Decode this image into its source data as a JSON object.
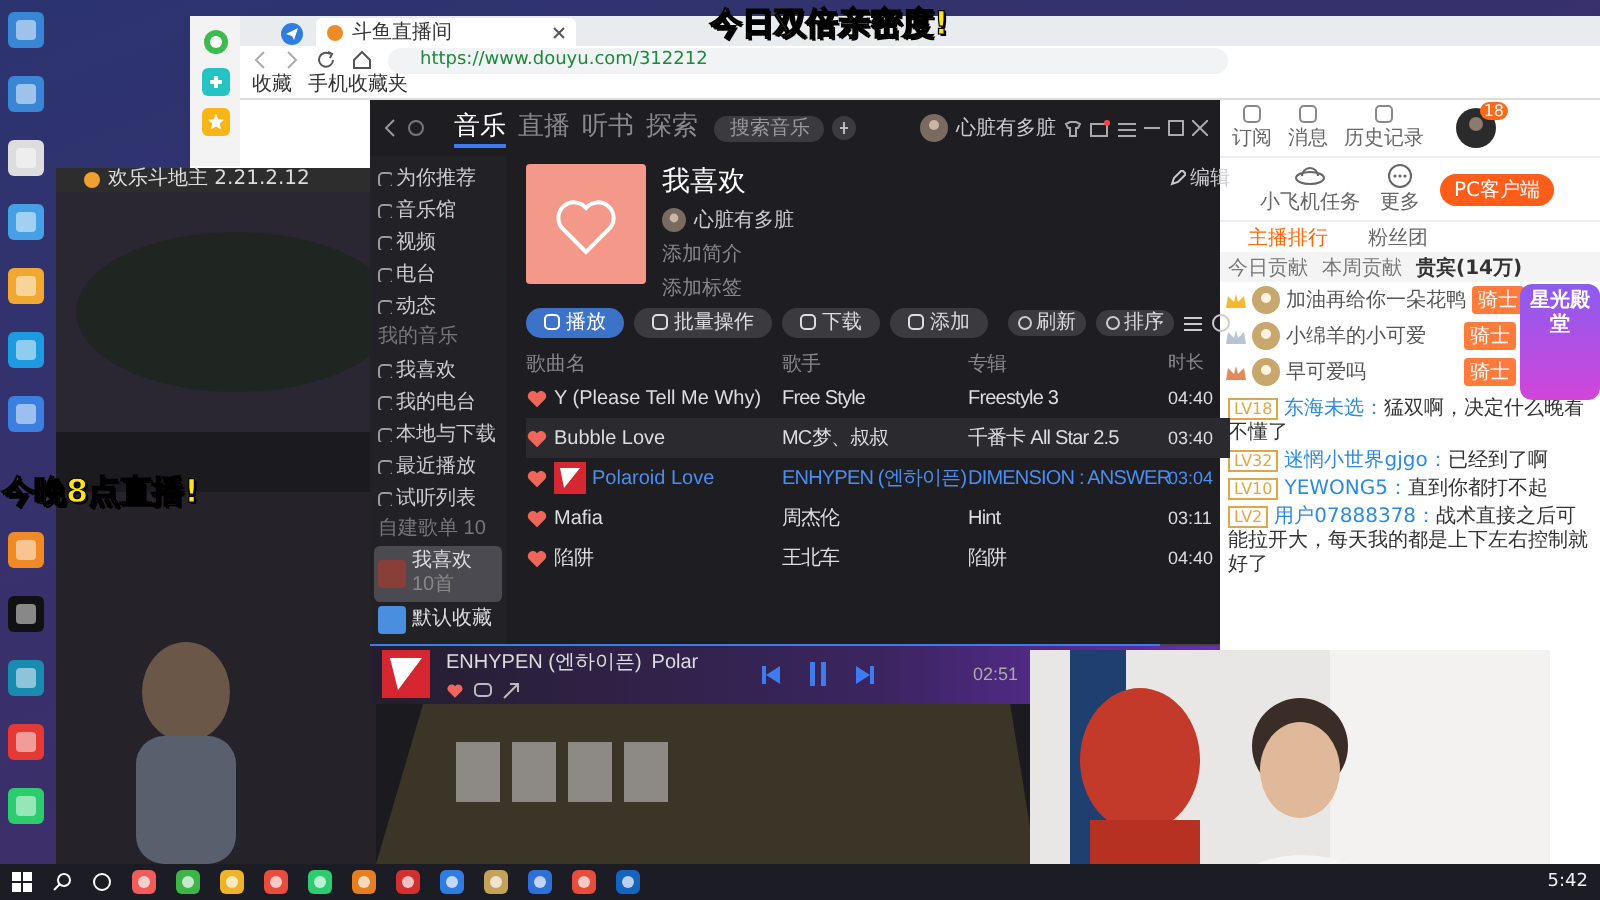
{
  "overlays": [
    {
      "text": "今日双倍亲密度!"
    },
    {
      "text": "今晚8点直播!"
    }
  ],
  "browser": {
    "tab_title": "斗鱼直播间",
    "url": "https://www.douyu.com/312212",
    "bookmarks": [
      "收藏",
      "手机收藏夹"
    ]
  },
  "game_window": {
    "title": "欢乐斗地主 2.21.2.12"
  },
  "music": {
    "nav": [
      {
        "label": "音乐",
        "selected": true
      },
      {
        "label": "直播",
        "selected": false
      },
      {
        "label": "听书",
        "selected": false
      },
      {
        "label": "探索",
        "selected": false
      }
    ],
    "search": {
      "placeholder": "搜索音乐"
    },
    "user": "心脏有多脏",
    "sidebar": [
      {
        "kind": "item",
        "label": "为你推荐",
        "selected": false
      },
      {
        "kind": "item",
        "label": "音乐馆",
        "selected": false
      },
      {
        "kind": "item",
        "label": "视频",
        "selected": false
      },
      {
        "kind": "item",
        "label": "电台",
        "selected": false
      },
      {
        "kind": "item",
        "label": "动态",
        "selected": false
      },
      {
        "kind": "heading",
        "label": "我的音乐"
      },
      {
        "kind": "item",
        "label": "我喜欢",
        "selected": false
      },
      {
        "kind": "item",
        "label": "我的电台",
        "selected": false
      },
      {
        "kind": "item",
        "label": "本地与下载",
        "selected": false
      },
      {
        "kind": "item",
        "label": "最近播放",
        "selected": false
      },
      {
        "kind": "item",
        "label": "试听列表",
        "selected": false
      },
      {
        "kind": "heading",
        "label": "自建歌单 10"
      },
      {
        "kind": "playlist",
        "label": "我喜欢",
        "count": "10首",
        "selected": true
      },
      {
        "kind": "playlist",
        "label": "默认收藏",
        "selected": false
      }
    ],
    "playlist": {
      "title": "我喜欢",
      "creator": "心脏有多脏",
      "intro": "添加简介",
      "tags": "添加标签",
      "edit": "编辑"
    },
    "actions": [
      {
        "label": "播放",
        "primary": true
      },
      {
        "label": "批量操作",
        "primary": false
      },
      {
        "label": "下载",
        "primary": false
      },
      {
        "label": "添加",
        "primary": false
      }
    ],
    "tools": [
      "刷新",
      "排序"
    ],
    "columns": [
      "歌曲名",
      "歌手",
      "专辑",
      "时长"
    ],
    "rows": [
      {
        "title": "Y (Please Tell Me Why)",
        "artist": "Free Style",
        "album": "Freestyle 3",
        "duration": "04:40",
        "liked": true,
        "playing": false,
        "selected": false
      },
      {
        "title": "Bubble Love",
        "artist": "MC梦、叔叔",
        "album": "千番卡 All Star 2.5",
        "duration": "03:40",
        "liked": true,
        "playing": false,
        "selected": true
      },
      {
        "title": "Polaroid Love",
        "artist": "ENHYPEN (엔하이픈)",
        "album": "DIMENSION : ANSWER",
        "duration": "03:04",
        "liked": true,
        "playing": true,
        "selected": false
      },
      {
        "title": "Mafia",
        "artist": "周杰伦",
        "album": "Hint",
        "duration": "03:11",
        "liked": true,
        "playing": false,
        "selected": false
      },
      {
        "title": "陷阱",
        "artist": "王北车",
        "album": "陷阱",
        "duration": "04:40",
        "liked": true,
        "playing": false,
        "selected": false
      }
    ],
    "now_playing": {
      "artist": "ENHYPEN (엔하이픈)",
      "title": "Polar",
      "time": "02:51",
      "liked": true,
      "playing": true,
      "level": 0.93
    }
  },
  "douyu": {
    "top_links": [
      "订阅",
      "消息",
      "历史记录"
    ],
    "notice_count": "18",
    "links": [
      "小飞机任务",
      "更多"
    ],
    "client_button": "PC客户端",
    "rank_tabs": [
      {
        "label": "主播排行",
        "selected": true
      },
      {
        "label": "粉丝团",
        "selected": false
      }
    ],
    "rank_subtabs": [
      {
        "label": "今日贡献",
        "selected": false
      },
      {
        "label": "本周贡献",
        "selected": false
      },
      {
        "label": "贵宾(14万)",
        "selected": true
      }
    ],
    "ranking": [
      {
        "name": "加油再给你一朵花鸭",
        "badge": "骑士",
        "color": "#f5b82e"
      },
      {
        "name": "小绵羊的小可爱",
        "badge": "骑士",
        "color": "#b9c3d6"
      },
      {
        "name": "早可爱吗",
        "badge": "骑士",
        "color": "#e38b5a"
      }
    ],
    "promo": "星光殿堂",
    "chat": [
      {
        "level": "LV18",
        "user": "东海未选：",
        "text": "猛双啊，决定什么晚看不懂了"
      },
      {
        "level": "LV32",
        "user": "迷惘小世界gjgo：",
        "text": "已经到了啊"
      },
      {
        "level": "LV10",
        "user": "YEWONG5：",
        "text": "直到你都打不起"
      },
      {
        "level": "LV2",
        "user": "用户07888378：",
        "text": "战术直接之后可能拉开大，每天我的都是上下左右控制就好了"
      }
    ]
  },
  "taskbar": {
    "time": "5:42"
  }
}
